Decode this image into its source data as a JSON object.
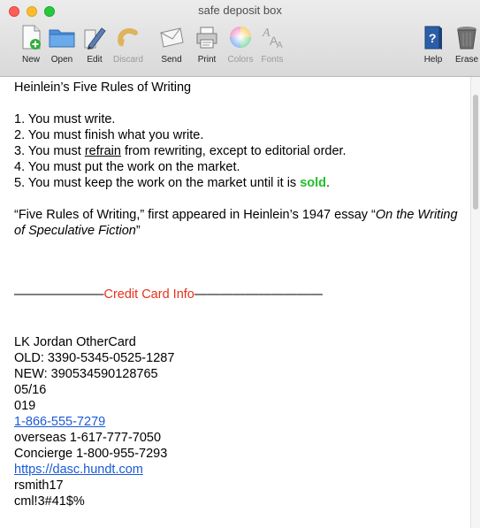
{
  "window": {
    "title": "safe deposit box"
  },
  "toolbar": {
    "items": [
      {
        "label": "New",
        "icon": "new-document-icon",
        "enabled": true
      },
      {
        "label": "Open",
        "icon": "open-folder-icon",
        "enabled": true
      },
      {
        "label": "Edit",
        "icon": "edit-icon",
        "enabled": true
      },
      {
        "label": "Discard",
        "icon": "discard-icon",
        "enabled": false
      },
      {
        "label": "Send",
        "icon": "send-icon",
        "enabled": true
      },
      {
        "label": "Print",
        "icon": "printer-icon",
        "enabled": true
      },
      {
        "label": "Colors",
        "icon": "color-wheel-icon",
        "enabled": false
      },
      {
        "label": "Fonts",
        "icon": "fonts-icon",
        "enabled": false
      },
      {
        "label": "Help",
        "icon": "help-icon",
        "enabled": true
      },
      {
        "label": "Erase",
        "icon": "trash-icon",
        "enabled": true
      }
    ]
  },
  "document": {
    "heading": "Heinlein’s Five Rules of Writing",
    "rules": {
      "r1": "1. You must write.",
      "r2": "2. You must finish what you write.",
      "r3_pre": "3. You must ",
      "r3_word": "refrain",
      "r3_post": " from rewriting, except to editorial order.",
      "r4": "4. You must put the work on the market.",
      "r5_pre": "5. You must keep the work on the market until it is ",
      "r5_word": "sold",
      "r5_post": "."
    },
    "quote": {
      "pre": "“Five Rules of Writing,” first appeared in Heinlein’s 1947 essay “",
      "title": "On the Writing of Speculative Fiction",
      "post": "”"
    },
    "divider": {
      "left": "———————",
      "label": "Credit Card Info",
      "right": "——————————"
    },
    "card": {
      "name": "LK Jordan  OtherCard",
      "old": "OLD: 3390-5345-0525-1287",
      "new": "NEW: 390534590128765",
      "expiry": "05/16",
      "cvv": "019",
      "phone": "1-866-555-7279",
      "overseas": "overseas 1-617-777-7050",
      "concierge": "Concierge 1-800-955-7293",
      "website": "https://dasc.hundt.com",
      "username": "rsmith17",
      "password": "cml!3#41$%"
    }
  },
  "colors": {
    "accent_green": "#22c12a",
    "accent_red": "#e8321a",
    "link_blue": "#1a5ad9"
  }
}
